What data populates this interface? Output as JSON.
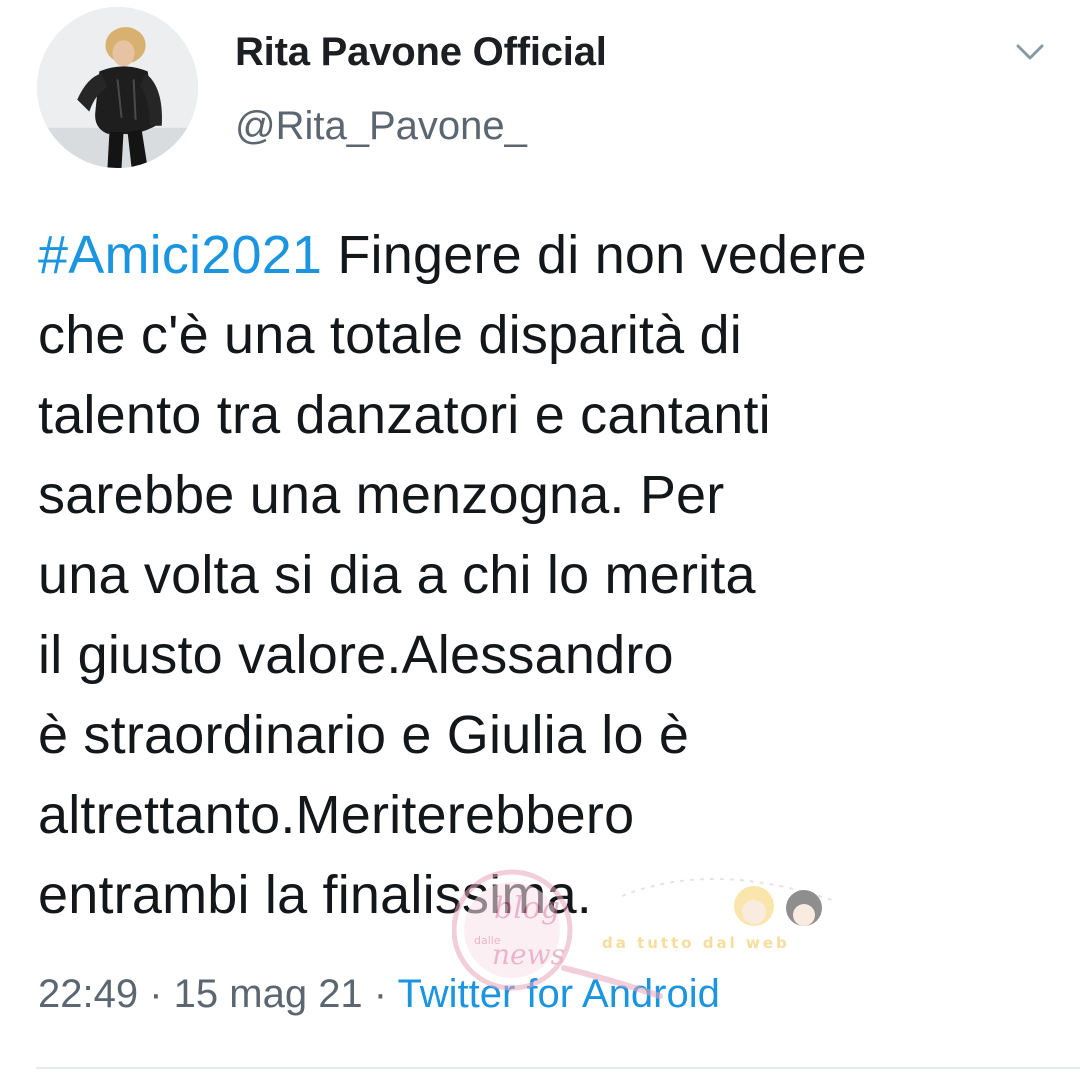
{
  "tweet": {
    "author": {
      "display_name": "Rita Pavone Official",
      "handle": "@Rita_Pavone_"
    },
    "text_lines": [
      {
        "hashtag": "#Amici2021",
        "text": " Fingere di non vedere"
      },
      {
        "hashtag": "",
        "text": "che c'è una totale disparità di"
      },
      {
        "hashtag": "",
        "text": "talento tra danzatori e cantanti"
      },
      {
        "hashtag": "",
        "text": "sarebbe una menzogna. Per"
      },
      {
        "hashtag": "",
        "text": "una volta si dia a chi lo merita"
      },
      {
        "hashtag": "",
        "text": "il giusto valore.Alessandro"
      },
      {
        "hashtag": "",
        "text": "è straordinario e Giulia lo è"
      },
      {
        "hashtag": "",
        "text": "altrettanto.Meriterebbero"
      },
      {
        "hashtag": "",
        "text": "entrambi la finalissima."
      }
    ],
    "time": "22:49",
    "separator": " · ",
    "date": "15 mag 21",
    "source": "Twitter for Android"
  },
  "watermark": {
    "line1": "blog",
    "line2": "news",
    "small": "dalle",
    "tagline": "da tutto dal web"
  },
  "colors": {
    "link": "#1b95e0",
    "text": "#14171a",
    "muted": "#5b6670",
    "divider": "#e6ecf0"
  },
  "icons": {
    "menu": "chevron-down-icon"
  }
}
